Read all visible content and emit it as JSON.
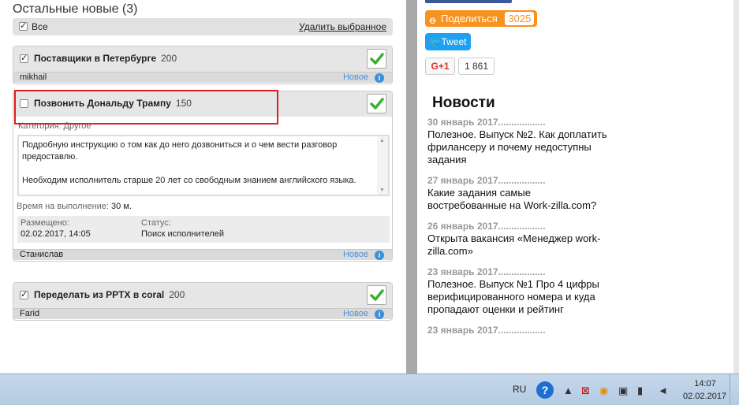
{
  "section": {
    "title": "Остальные новые (3)"
  },
  "select_bar": {
    "all_label": "Все",
    "delete_label": "Удалить выбранное"
  },
  "tasks": [
    {
      "title": "Поставщики в Петербурге",
      "price": "200",
      "user": "mikhail",
      "status": "Новое"
    },
    {
      "title": "Позвонить Дональду Трампу",
      "price": "150",
      "category": "Категория: Другое",
      "description_line1": "Подробную инструкцию о том как до него дозвониться и о чем вести разговор предоставлю.",
      "description_line2": "Необходим исполнитель старше 20 лет со свободным знанием английского языка.",
      "exec_label": "Время на выполнение:",
      "exec_value": "30 м.",
      "placed_label": "Размещено:",
      "placed_value": "02.02.2017, 14:05",
      "status_label": "Статус:",
      "status_value": "Поиск исполнителей",
      "user": "Станислав",
      "status": "Новое"
    },
    {
      "title": "Переделать из PPTX в coral",
      "price": "200",
      "user": "Farid",
      "status": "Новое"
    }
  ],
  "share": {
    "ok_label": "Поделиться",
    "ok_count": "3025",
    "tweet_label": "Tweet",
    "gplus_label": "G+1",
    "gplus_count": "1 861"
  },
  "news": {
    "title": "Новости",
    "items": [
      {
        "date": "30 январь 2017..................",
        "text": "Полезное. Выпуск №2. Как доплатить фрилансеру и почему недоступны задания"
      },
      {
        "date": "27 январь 2017..................",
        "text": "Какие задания самые востребованные на Work-zilla.com?"
      },
      {
        "date": "26 январь 2017..................",
        "text": "Открыта вакансия «Менеджер work-zilla.com»"
      },
      {
        "date": "23 январь 2017..................",
        "text": "Полезное. Выпуск №1 Про 4 цифры верифицированного номера и куда пропадают оценки и рейтинг"
      },
      {
        "date": "23 январь 2017..................",
        "text": ""
      }
    ]
  },
  "taskbar": {
    "lang": "RU",
    "time": "14:07",
    "date": "02.02.2017"
  },
  "colors": {
    "accent_ok": "#f7931e",
    "accent_twitter": "#1da1f2",
    "highlight": "#e01e1e",
    "link_blue": "#4a90d9"
  }
}
